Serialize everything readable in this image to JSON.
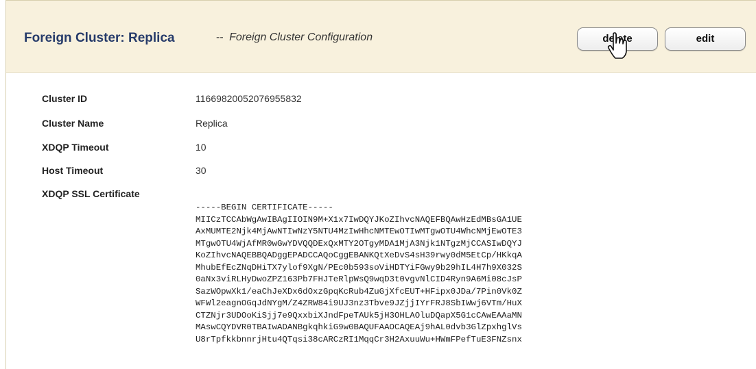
{
  "header": {
    "title": "Foreign Cluster: Replica",
    "subtitle_sep": "--",
    "subtitle": "Foreign Cluster Configuration",
    "delete_label": "delete",
    "edit_label": "edit"
  },
  "fields": {
    "cluster_id": {
      "label": "Cluster ID",
      "value": "11669820052076955832"
    },
    "cluster_name": {
      "label": "Cluster Name",
      "value": "Replica"
    },
    "xdqp_timeout": {
      "label": "XDQP Timeout",
      "value": "10"
    },
    "host_timeout": {
      "label": "Host Timeout",
      "value": "30"
    },
    "ssl_cert": {
      "label": "XDQP SSL Certificate",
      "lines": [
        "-----BEGIN CERTIFICATE-----",
        "MIICzTCCAbWgAwIBAgIIOIN9M+X1x7IwDQYJKoZIhvcNAQEFBQAwHzEdMBsGA1UE",
        "AxMUMTE2Njk4MjAwNTIwNzY5NTU4MzIwHhcNMTEwOTIwMTgwOTU4WhcNMjEwOTE3",
        "MTgwOTU4WjAfMR0wGwYDVQQDExQxMTY2OTgyMDA1MjA3Njk1NTgzMjCCASIwDQYJ",
        "KoZIhvcNAQEBBQADggEPADCCAQoCggEBANKQtXeDvS4sH39rwy0dM5EtCp/HKkqA",
        "MhubEfEcZNqDHiTX7ylof9XgN/PEc0b593soViHDTYiFGwy9b29hIL4H7h9X032S",
        "0aNx3viRLHyDwoZPZ163Pb7FHJTeRlpWsQ9wqD3t0vgvNlCID4Ryn9A6Mi08cJsP",
        "SazWOpwXk1/eaChJeXDx6dOxzGpqKcRub4ZuGjXfcEUT+HFipx0JDa/7Pin0Vk0Z",
        "WFWl2eagnOGqJdNYgM/Z4ZRW84i9UJ3nz3Tbve9JZjjIYrFRJ8SbIWwj6VTm/HuX",
        "CTZNjr3UDOoKiSjj7e9QxxbiXJndFpeTAUk5jH3OHLAOluDQapX5G1cCAwEAAaMN",
        "MAswCQYDVR0TBAIwADANBgkqhkiG9w0BAQUFAAOCAQEAj9hAL0dvb3GlZpxhglVs",
        "U8rTpfkkbnnrjHtu4QTqsi38cARCzRI1MqqCr3H2AxuuWu+HWmFPefTuE3FNZsnx"
      ]
    }
  },
  "cursor": {
    "icon": "hand-pointer-icon"
  },
  "colors": {
    "header_bg": "#f8f1dd",
    "title": "#263b6a"
  }
}
